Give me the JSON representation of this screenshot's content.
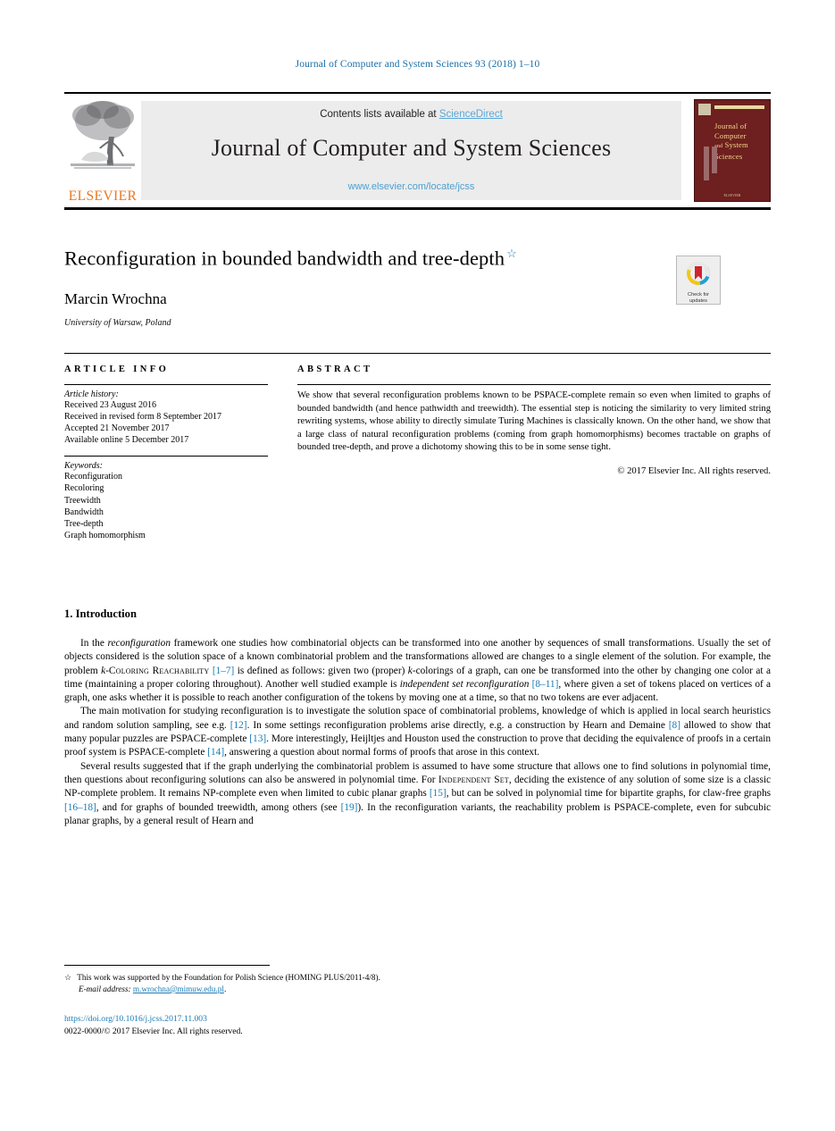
{
  "running_head": "Journal of Computer and System Sciences 93 (2018) 1–10",
  "masthead": {
    "contents_prefix": "Contents lists available at ",
    "sciencedirect": "ScienceDirect",
    "journal_title": "Journal of Computer and System Sciences",
    "journal_url": "www.elsevier.com/locate/jcss",
    "publisher": "ELSEVIER",
    "cover": {
      "line1": "Journal of",
      "line2": "Computer",
      "line3_small": "and",
      "line3": "System",
      "line4": "Sciences",
      "footer": "ELSEVIER"
    }
  },
  "title_block": {
    "title": "Reconfiguration in bounded bandwidth and tree-depth",
    "title_footnote_marker": "☆",
    "author": "Marcin Wrochna",
    "affiliation": "University of Warsaw, Poland"
  },
  "crossmark": {
    "line1": "Check for",
    "line2": "updates"
  },
  "article_info": {
    "heading": "ARTICLE INFO",
    "history_label": "Article history:",
    "history": [
      "Received 23 August 2016",
      "Received in revised form 8 September 2017",
      "Accepted 21 November 2017",
      "Available online 5 December 2017"
    ],
    "keywords_label": "Keywords:",
    "keywords": [
      "Reconfiguration",
      "Recoloring",
      "Treewidth",
      "Bandwidth",
      "Tree-depth",
      "Graph homomorphism"
    ]
  },
  "abstract": {
    "heading": "ABSTRACT",
    "text": "We show that several reconfiguration problems known to be PSPACE-complete remain so even when limited to graphs of bounded bandwidth (and hence pathwidth and treewidth). The essential step is noticing the similarity to very limited string rewriting systems, whose ability to directly simulate Turing Machines is classically known. On the other hand, we show that a large class of natural reconfiguration problems (coming from graph homomorphisms) becomes tractable on graphs of bounded tree-depth, and prove a dichotomy showing this to be in some sense tight.",
    "copyright": "© 2017 Elsevier Inc. All rights reserved."
  },
  "introduction": {
    "heading": "1. Introduction",
    "paragraphs": [
      "In the reconfiguration framework one studies how combinatorial objects can be transformed into one another by sequences of small transformations. Usually the set of objects considered is the solution space of a known combinatorial problem and the transformations allowed are changes to a single element of the solution. For example, the problem k-Coloring Reachability [1–7] is defined as follows: given two (proper) k-colorings of a graph, can one be transformed into the other by changing one color at a time (maintaining a proper coloring throughout). Another well studied example is independent set reconfiguration [8–11], where given a set of tokens placed on vertices of a graph, one asks whether it is possible to reach another configuration of the tokens by moving one at a time, so that no two tokens are ever adjacent.",
      "The main motivation for studying reconfiguration is to investigate the solution space of combinatorial problems, knowledge of which is applied in local search heuristics and random solution sampling, see e.g. [12]. In some settings reconfiguration problems arise directly, e.g. a construction by Hearn and Demaine [8] allowed to show that many popular puzzles are PSPACE-complete [13]. More interestingly, Heijltjes and Houston used the construction to prove that deciding the equivalence of proofs in a certain proof system is PSPACE-complete [14], answering a question about normal forms of proofs that arose in this context.",
      "Several results suggested that if the graph underlying the combinatorial problem is assumed to have some structure that allows one to find solutions in polynomial time, then questions about reconfiguring solutions can also be answered in polynomial time. For Independent Set, deciding the existence of any solution of some size is a classic NP-complete problem. It remains NP-complete even when limited to cubic planar graphs [15], but can be solved in polynomial time for bipartite graphs, for claw-free graphs [16–18], and for graphs of bounded treewidth, among others (see [19]). In the reconfiguration variants, the reachability problem is PSPACE-complete, even for subcubic planar graphs, by a general result of Hearn and"
    ]
  },
  "footnotes": {
    "star_marker": "☆",
    "funding": "This work was supported by the Foundation for Polish Science (HOMING PLUS/2011-4/8).",
    "email_label": "E-mail address:",
    "email": "m.wrochna@mimuw.edu.pl",
    "email_period": "."
  },
  "footer": {
    "doi": "https://doi.org/10.1016/j.jcss.2017.11.003",
    "issn_line": "0022-0000/© 2017 Elsevier Inc. All rights reserved."
  },
  "colors": {
    "link_blue": "#1a7ab5",
    "sciencedirect_blue": "#5aa7d8",
    "elsevier_orange": "#e87722",
    "cover_maroon": "#6e1f1f"
  }
}
